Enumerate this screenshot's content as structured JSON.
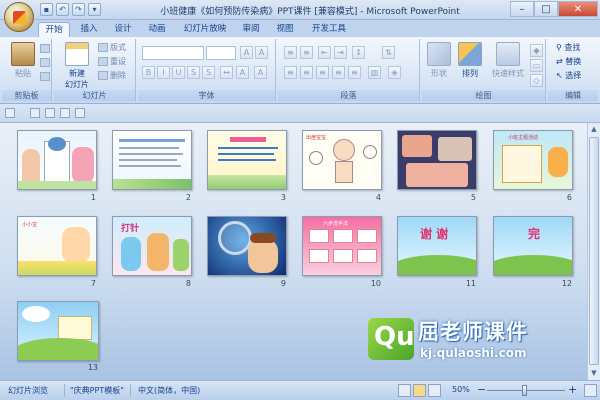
{
  "window": {
    "title": "小班健康《如何预防传染病》PPT课件 [兼容模式] - Microsoft PowerPoint"
  },
  "ribbon": {
    "tabs": [
      "开始",
      "插入",
      "设计",
      "动画",
      "幻灯片放映",
      "审阅",
      "视图",
      "开发工具"
    ],
    "active_tab": "开始",
    "clipboard": {
      "paste": "粘贴",
      "label": "剪贴板"
    },
    "slides": {
      "new_slide": "新建",
      "new_slide2": "幻灯片",
      "layout": "版式",
      "reset": "重设",
      "delete": "删除",
      "label": "幻灯片"
    },
    "font": {
      "label": "字体"
    },
    "paragraph": {
      "label": "段落"
    },
    "drawing": {
      "shape": "形状",
      "arrange": "排列",
      "quick_styles": "快速样式",
      "label": "绘图"
    },
    "editing": {
      "find": "查找",
      "replace": "替换",
      "select": "选择",
      "label": "编辑"
    }
  },
  "slides": [
    {
      "num": "1"
    },
    {
      "num": "2"
    },
    {
      "num": "3"
    },
    {
      "num": "4"
    },
    {
      "num": "5"
    },
    {
      "num": "6"
    },
    {
      "num": "7"
    },
    {
      "num": "8"
    },
    {
      "num": "9"
    },
    {
      "num": "10"
    },
    {
      "num": "11"
    },
    {
      "num": "12"
    },
    {
      "num": "13"
    }
  ],
  "slide_text": {
    "s4_title": "出痘宝宝",
    "s6_title": "小班主题活动",
    "s7_title": "小小宝",
    "s8_title": "打针",
    "s10_title": "六步洗手法",
    "s11_text": "谢 谢",
    "s12_text": "完"
  },
  "watermark": {
    "brand": "屈老师课件",
    "url": "kj.qulaoshi.com"
  },
  "status": {
    "view": "幻灯片浏览",
    "theme": "\"庆典PPT模板\"",
    "language": "中文(简体，中国)",
    "zoom": "50%",
    "zoom_level": 0.5
  },
  "colors": {
    "accent": "#15428b",
    "ribbon": "#dbe7f6",
    "workspace": "#cdddf0"
  }
}
